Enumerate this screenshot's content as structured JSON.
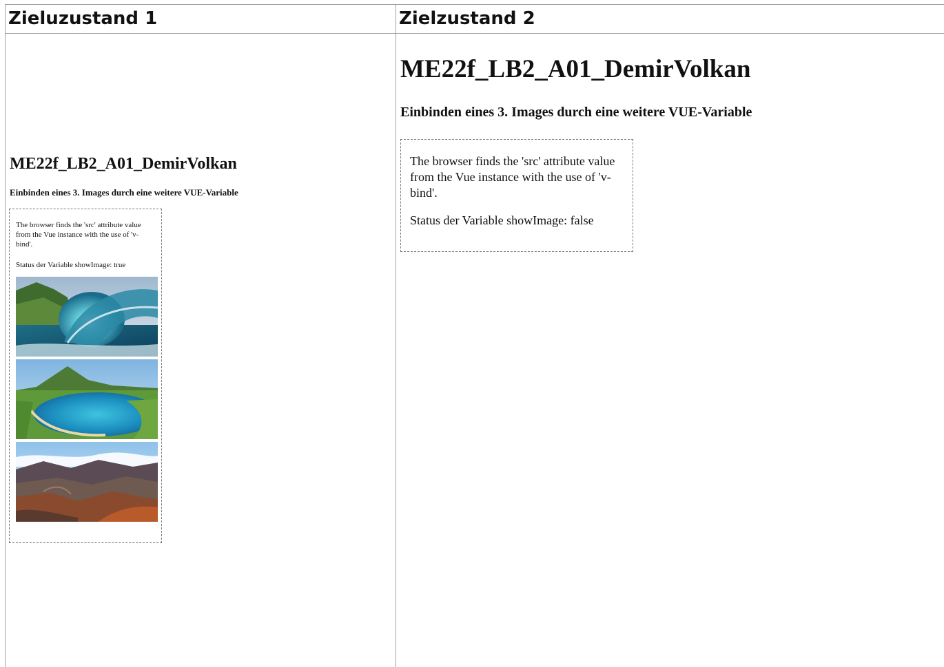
{
  "columns": {
    "left_header": "Zieluzustand 1",
    "right_header": "Zielzustand 2"
  },
  "state1": {
    "title": "ME22f_LB2_A01_DemirVolkan",
    "subtitle": "Einbinden eines 3. Images durch eine weitere VUE-Variable",
    "description": "The browser finds the 'src' attribute value from the Vue instance with the use of 'v-bind'.",
    "status": "Status der Variable showImage: true",
    "images": [
      "wave-image",
      "bay-image",
      "crater-image"
    ]
  },
  "state2": {
    "title": "ME22f_LB2_A01_DemirVolkan",
    "subtitle": "Einbinden eines 3. Images durch eine weitere VUE-Variable",
    "description": "The browser finds the 'src' attribute value from the Vue instance with the use of 'v-bind'.",
    "status": "Status der Variable showImage: false"
  }
}
